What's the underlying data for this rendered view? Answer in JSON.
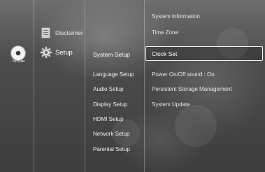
{
  "disc": {
    "icon": "no-disc-icon",
    "label": "No Disc"
  },
  "main_menu": [
    {
      "label": "Disclaimer",
      "icon": "document-icon"
    },
    {
      "label": "Setup",
      "icon": "gear-icon",
      "selected": true
    }
  ],
  "setup_menu": [
    {
      "label": "System Setup",
      "selected": true
    },
    {
      "label": "Language Setup"
    },
    {
      "label": "Audio Setup"
    },
    {
      "label": "Display Setup"
    },
    {
      "label": "HDMI Setup"
    },
    {
      "label": "Network Setup"
    },
    {
      "label": "Parental Setup"
    }
  ],
  "system_menu": [
    {
      "label": "System Information"
    },
    {
      "label": "Time Zone"
    },
    {
      "label": "Clock Set",
      "highlighted": true
    },
    {
      "label": "Power On/Off sound   :  On"
    },
    {
      "label": "Persistent Storage Management"
    },
    {
      "label": "System Update"
    }
  ],
  "colors": {
    "background": "#4c4c4c",
    "text": "#e8e8e8",
    "highlight_border": "#f4f4f4"
  }
}
